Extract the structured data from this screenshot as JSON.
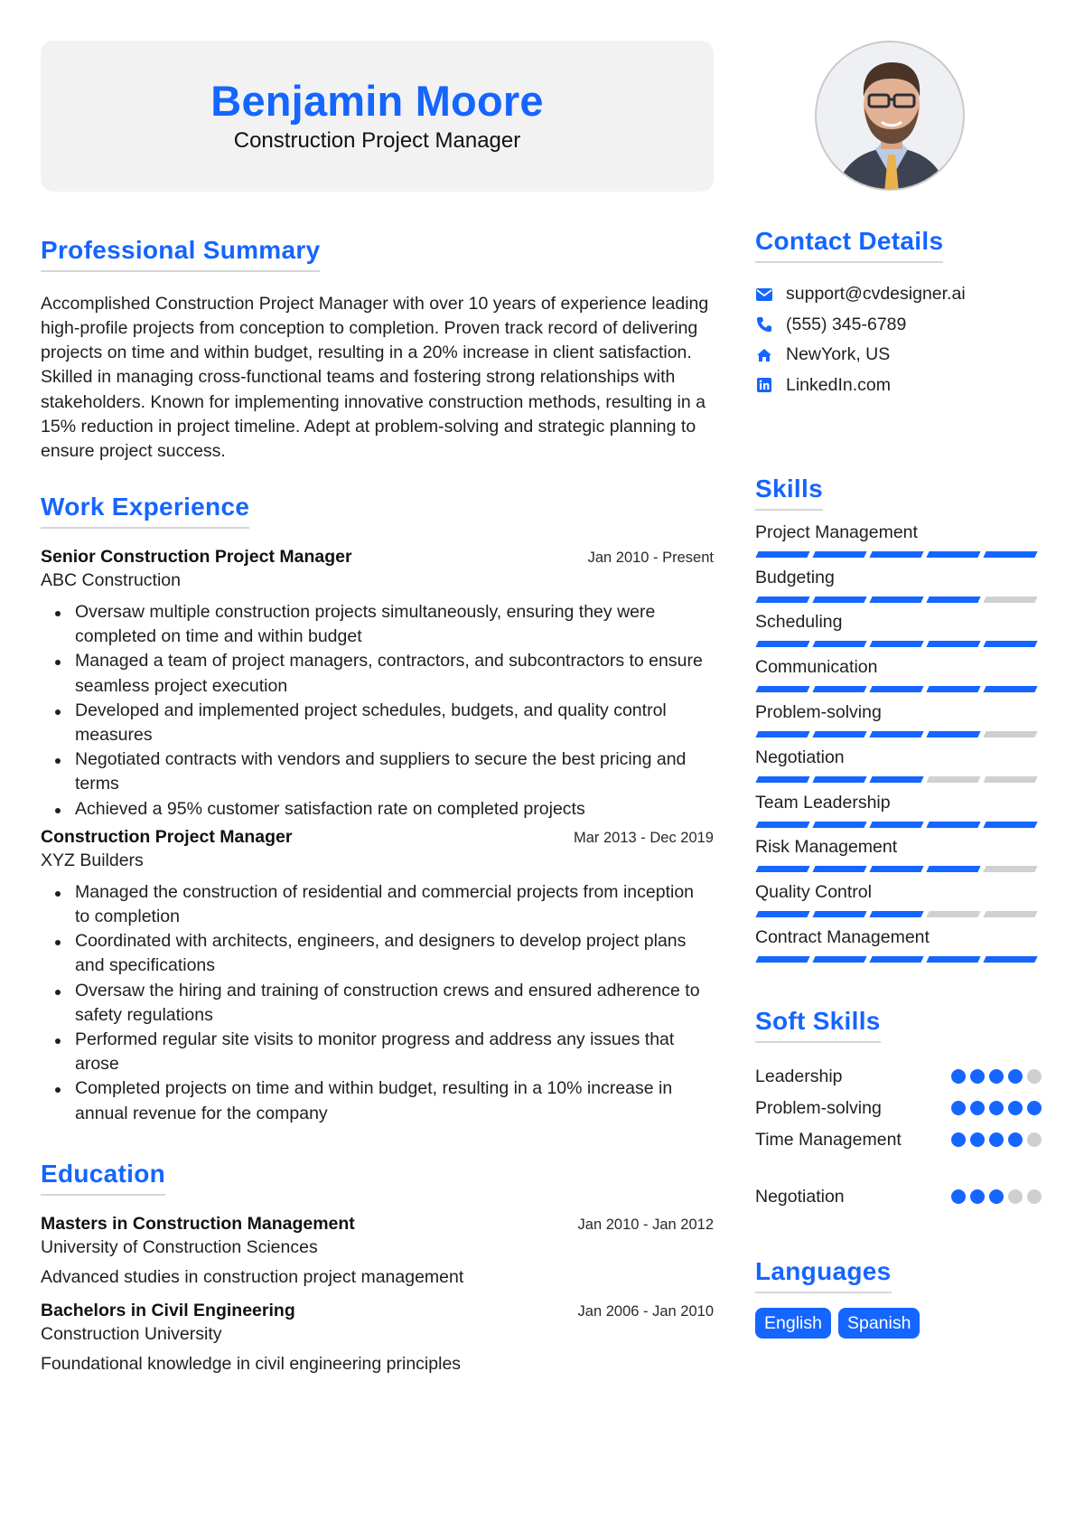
{
  "header": {
    "name": "Benjamin Moore",
    "title": "Construction Project Manager"
  },
  "theme": {
    "accent": "#1565ff",
    "muted": "#d0d0d0",
    "header_bg": "#f2f2f2"
  },
  "summary": {
    "heading": "Professional Summary",
    "text": "Accomplished Construction Project Manager with over 10 years of experience leading high-profile projects from conception to completion. Proven track record of delivering projects on time and within budget, resulting in a 20% increase in client satisfaction. Skilled in managing cross-functional teams and fostering strong relationships with stakeholders. Known for implementing innovative construction methods, resulting in a 15% reduction in project timeline. Adept at problem-solving and strategic planning to ensure project success."
  },
  "work": {
    "heading": "Work Experience",
    "jobs": [
      {
        "title": "Senior Construction Project Manager",
        "company": "ABC Construction",
        "dates": "Jan 2010 - Present",
        "bullets": [
          "Oversaw multiple construction projects simultaneously, ensuring they were completed on time and within budget",
          "Managed a team of project managers, contractors, and subcontractors to ensure seamless project execution",
          "Developed and implemented project schedules, budgets, and quality control measures",
          "Negotiated contracts with vendors and suppliers to secure the best pricing and terms",
          "Achieved a 95% customer satisfaction rate on completed projects"
        ]
      },
      {
        "title": "Construction Project Manager",
        "company": "XYZ Builders",
        "dates": "Mar 2013 - Dec 2019",
        "bullets": [
          "Managed the construction of residential and commercial projects from inception to completion",
          "Coordinated with architects, engineers, and designers to develop project plans and specifications",
          "Oversaw the hiring and training of construction crews and ensured adherence to safety regulations",
          "Performed regular site visits to monitor progress and address any issues that arose",
          "Completed projects on time and within budget, resulting in a 10% increase in annual revenue for the company"
        ]
      }
    ]
  },
  "education": {
    "heading": "Education",
    "items": [
      {
        "degree": "Masters in Construction Management",
        "school": "University of Construction Sciences",
        "dates": "Jan 2010 - Jan 2012",
        "description": "Advanced studies in construction project management"
      },
      {
        "degree": "Bachelors in Civil Engineering",
        "school": "Construction University",
        "dates": "Jan 2006 - Jan 2010",
        "description": "Foundational knowledge in civil engineering principles"
      }
    ]
  },
  "contact": {
    "heading": "Contact Details",
    "items": [
      {
        "icon": "envelope-icon",
        "text": "support@cvdesigner.ai"
      },
      {
        "icon": "phone-icon",
        "text": "(555) 345-6789"
      },
      {
        "icon": "home-icon",
        "text": "NewYork, US"
      },
      {
        "icon": "linkedin-icon",
        "text": "LinkedIn.com"
      }
    ]
  },
  "skills": {
    "heading": "Skills",
    "max": 5,
    "items": [
      {
        "name": "Project Management",
        "level": 5
      },
      {
        "name": "Budgeting",
        "level": 4
      },
      {
        "name": "Scheduling",
        "level": 5
      },
      {
        "name": "Communication",
        "level": 5
      },
      {
        "name": "Problem-solving",
        "level": 4
      },
      {
        "name": "Negotiation",
        "level": 3
      },
      {
        "name": "Team Leadership",
        "level": 5
      },
      {
        "name": "Risk Management",
        "level": 4
      },
      {
        "name": "Quality Control",
        "level": 3
      },
      {
        "name": "Contract Management",
        "level": 5
      }
    ]
  },
  "soft_skills": {
    "heading": "Soft Skills",
    "max": 5,
    "items": [
      {
        "name": "Leadership",
        "level": 4
      },
      {
        "name": "Problem-solving",
        "level": 5
      },
      {
        "name": "Time Management",
        "level": 4
      },
      {
        "name": "Negotiation",
        "level": 3
      }
    ]
  },
  "languages": {
    "heading": "Languages",
    "items": [
      "English",
      "Spanish"
    ]
  }
}
